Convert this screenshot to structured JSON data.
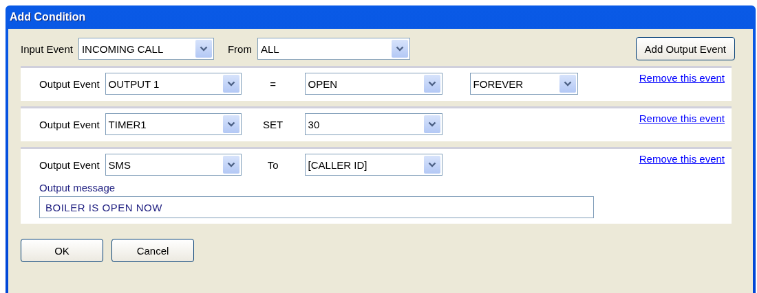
{
  "window": {
    "title": "Add Condition"
  },
  "input_event": {
    "label": "Input Event",
    "value": "INCOMING CALL"
  },
  "from": {
    "label": "From",
    "value": "ALL"
  },
  "add_button": "Add Output Event",
  "events": [
    {
      "label": "Output Event",
      "output": "OUTPUT 1",
      "operator": "=",
      "value": "OPEN",
      "duration": "FOREVER",
      "remove_link": "Remove this event"
    },
    {
      "label": "Output Event",
      "output": "TIMER1",
      "operator": "SET",
      "value": "30",
      "remove_link": "Remove this event"
    },
    {
      "label": "Output Event",
      "output": "SMS",
      "operator": "To",
      "value": "[CALLER ID]",
      "remove_link": "Remove this event",
      "message_label": "Output message",
      "message": "BOILER IS OPEN NOW"
    }
  ],
  "buttons": [
    "OK",
    "Cancel"
  ]
}
